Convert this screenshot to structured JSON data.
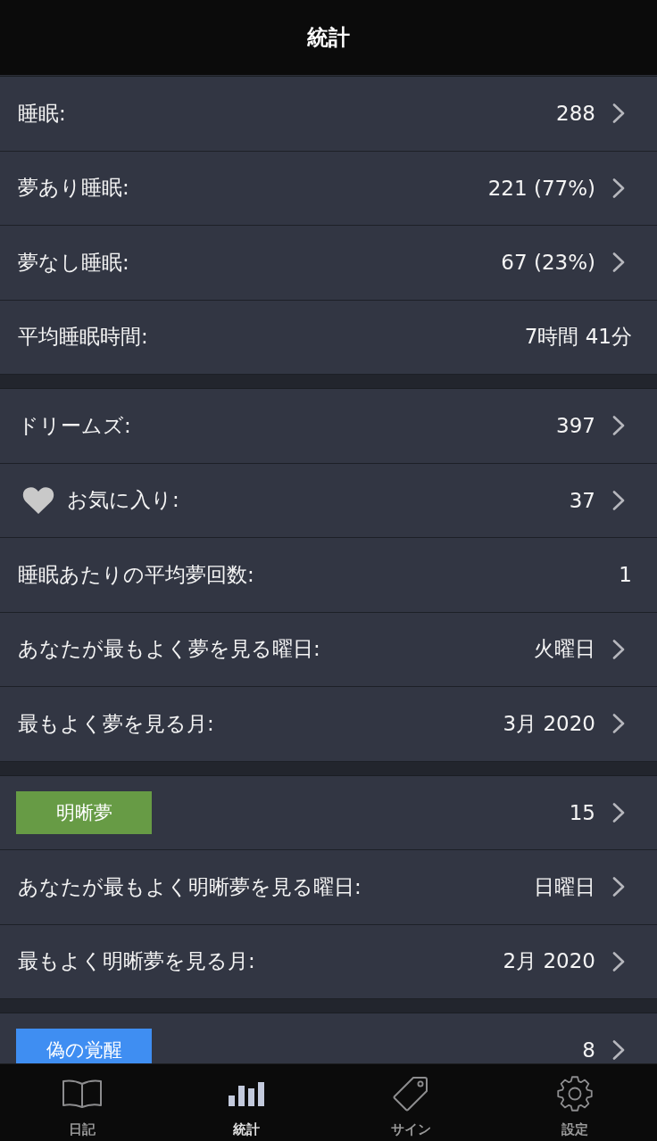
{
  "header": {
    "title": "統計"
  },
  "sections": [
    {
      "rows": [
        {
          "kind": "plain",
          "label": "睡眠:",
          "value": "288",
          "disclosure": true
        },
        {
          "kind": "plain",
          "label": "夢あり睡眠:",
          "value": "221 (77%)",
          "disclosure": true
        },
        {
          "kind": "plain",
          "label": "夢なし睡眠:",
          "value": "67 (23%)",
          "disclosure": true
        },
        {
          "kind": "plain",
          "label": "平均睡眠時間:",
          "value": "7時間 41分",
          "disclosure": false
        }
      ]
    },
    {
      "rows": [
        {
          "kind": "plain",
          "label": "ドリームズ:",
          "value": "397",
          "disclosure": true
        },
        {
          "kind": "favorite",
          "label": "お気に入り:",
          "value": "37",
          "disclosure": true
        },
        {
          "kind": "plain",
          "label": "睡眠あたりの平均夢回数:",
          "value": "1",
          "disclosure": false
        },
        {
          "kind": "plain",
          "label": "あなたが最もよく夢を見る曜日:",
          "value": "火曜日",
          "disclosure": true
        },
        {
          "kind": "plain",
          "label": "最もよく夢を見る月:",
          "value": "3月 2020",
          "disclosure": true
        }
      ]
    },
    {
      "rows": [
        {
          "kind": "badge",
          "label": "明晰夢",
          "color": "#679b45",
          "value": "15",
          "disclosure": true
        },
        {
          "kind": "plain",
          "label": "あなたが最もよく明晰夢を見る曜日:",
          "value": "日曜日",
          "disclosure": true
        },
        {
          "kind": "plain",
          "label": "最もよく明晰夢を見る月:",
          "value": "2月 2020",
          "disclosure": true
        }
      ]
    },
    {
      "rows": [
        {
          "kind": "badge",
          "label": "偽の覚醒",
          "color": "#3f8ef2",
          "value": "8",
          "disclosure": true
        }
      ]
    }
  ],
  "tab_bar": {
    "tabs": [
      {
        "label": "日記",
        "selected": false
      },
      {
        "label": "統計",
        "selected": true
      },
      {
        "label": "サイン",
        "selected": false
      },
      {
        "label": "設定",
        "selected": false
      }
    ]
  }
}
